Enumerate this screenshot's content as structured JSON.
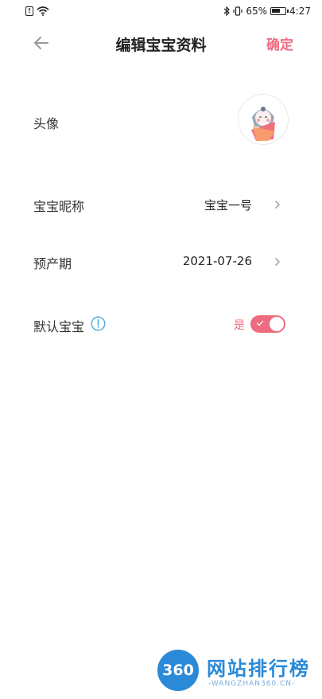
{
  "status_bar": {
    "sim_text": "!",
    "battery_percent": "65%",
    "time": "4:27"
  },
  "header": {
    "title": "编辑宝宝资料",
    "confirm_label": "确定"
  },
  "rows": {
    "avatar_label": "头像",
    "nickname_label": "宝宝昵称",
    "nickname_value": "宝宝一号",
    "due_date_label": "预产期",
    "due_date_value": "2021-07-26",
    "default_label": "默认宝宝",
    "default_value_label": "是",
    "default_on": true
  },
  "watermark": {
    "badge": "360",
    "title": "网站排行榜",
    "subtitle": "-WANGZHAN360.CN-"
  },
  "colors": {
    "accent": "#ee6c80",
    "watermark": "#2a8ad8"
  },
  "icons": [
    "sim-icon",
    "wifi-icon",
    "bluetooth-icon",
    "vibrate-icon",
    "battery-icon",
    "back-arrow-icon",
    "baby-avatar-icon",
    "chevron-right-icon",
    "info-icon",
    "check-icon"
  ]
}
